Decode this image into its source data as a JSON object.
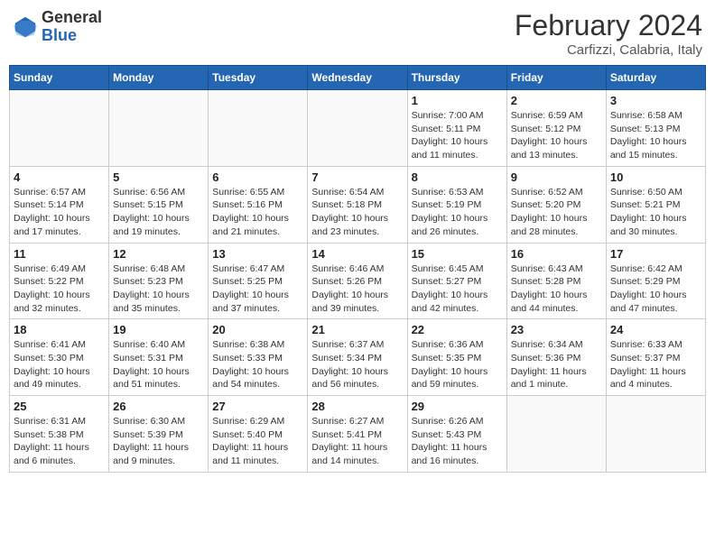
{
  "header": {
    "logo_line1": "General",
    "logo_line2": "Blue",
    "month_year": "February 2024",
    "location": "Carfizzi, Calabria, Italy"
  },
  "days_of_week": [
    "Sunday",
    "Monday",
    "Tuesday",
    "Wednesday",
    "Thursday",
    "Friday",
    "Saturday"
  ],
  "weeks": [
    [
      {
        "day": "",
        "info": ""
      },
      {
        "day": "",
        "info": ""
      },
      {
        "day": "",
        "info": ""
      },
      {
        "day": "",
        "info": ""
      },
      {
        "day": "1",
        "info": "Sunrise: 7:00 AM\nSunset: 5:11 PM\nDaylight: 10 hours\nand 11 minutes."
      },
      {
        "day": "2",
        "info": "Sunrise: 6:59 AM\nSunset: 5:12 PM\nDaylight: 10 hours\nand 13 minutes."
      },
      {
        "day": "3",
        "info": "Sunrise: 6:58 AM\nSunset: 5:13 PM\nDaylight: 10 hours\nand 15 minutes."
      }
    ],
    [
      {
        "day": "4",
        "info": "Sunrise: 6:57 AM\nSunset: 5:14 PM\nDaylight: 10 hours\nand 17 minutes."
      },
      {
        "day": "5",
        "info": "Sunrise: 6:56 AM\nSunset: 5:15 PM\nDaylight: 10 hours\nand 19 minutes."
      },
      {
        "day": "6",
        "info": "Sunrise: 6:55 AM\nSunset: 5:16 PM\nDaylight: 10 hours\nand 21 minutes."
      },
      {
        "day": "7",
        "info": "Sunrise: 6:54 AM\nSunset: 5:18 PM\nDaylight: 10 hours\nand 23 minutes."
      },
      {
        "day": "8",
        "info": "Sunrise: 6:53 AM\nSunset: 5:19 PM\nDaylight: 10 hours\nand 26 minutes."
      },
      {
        "day": "9",
        "info": "Sunrise: 6:52 AM\nSunset: 5:20 PM\nDaylight: 10 hours\nand 28 minutes."
      },
      {
        "day": "10",
        "info": "Sunrise: 6:50 AM\nSunset: 5:21 PM\nDaylight: 10 hours\nand 30 minutes."
      }
    ],
    [
      {
        "day": "11",
        "info": "Sunrise: 6:49 AM\nSunset: 5:22 PM\nDaylight: 10 hours\nand 32 minutes."
      },
      {
        "day": "12",
        "info": "Sunrise: 6:48 AM\nSunset: 5:23 PM\nDaylight: 10 hours\nand 35 minutes."
      },
      {
        "day": "13",
        "info": "Sunrise: 6:47 AM\nSunset: 5:25 PM\nDaylight: 10 hours\nand 37 minutes."
      },
      {
        "day": "14",
        "info": "Sunrise: 6:46 AM\nSunset: 5:26 PM\nDaylight: 10 hours\nand 39 minutes."
      },
      {
        "day": "15",
        "info": "Sunrise: 6:45 AM\nSunset: 5:27 PM\nDaylight: 10 hours\nand 42 minutes."
      },
      {
        "day": "16",
        "info": "Sunrise: 6:43 AM\nSunset: 5:28 PM\nDaylight: 10 hours\nand 44 minutes."
      },
      {
        "day": "17",
        "info": "Sunrise: 6:42 AM\nSunset: 5:29 PM\nDaylight: 10 hours\nand 47 minutes."
      }
    ],
    [
      {
        "day": "18",
        "info": "Sunrise: 6:41 AM\nSunset: 5:30 PM\nDaylight: 10 hours\nand 49 minutes."
      },
      {
        "day": "19",
        "info": "Sunrise: 6:40 AM\nSunset: 5:31 PM\nDaylight: 10 hours\nand 51 minutes."
      },
      {
        "day": "20",
        "info": "Sunrise: 6:38 AM\nSunset: 5:33 PM\nDaylight: 10 hours\nand 54 minutes."
      },
      {
        "day": "21",
        "info": "Sunrise: 6:37 AM\nSunset: 5:34 PM\nDaylight: 10 hours\nand 56 minutes."
      },
      {
        "day": "22",
        "info": "Sunrise: 6:36 AM\nSunset: 5:35 PM\nDaylight: 10 hours\nand 59 minutes."
      },
      {
        "day": "23",
        "info": "Sunrise: 6:34 AM\nSunset: 5:36 PM\nDaylight: 11 hours\nand 1 minute."
      },
      {
        "day": "24",
        "info": "Sunrise: 6:33 AM\nSunset: 5:37 PM\nDaylight: 11 hours\nand 4 minutes."
      }
    ],
    [
      {
        "day": "25",
        "info": "Sunrise: 6:31 AM\nSunset: 5:38 PM\nDaylight: 11 hours\nand 6 minutes."
      },
      {
        "day": "26",
        "info": "Sunrise: 6:30 AM\nSunset: 5:39 PM\nDaylight: 11 hours\nand 9 minutes."
      },
      {
        "day": "27",
        "info": "Sunrise: 6:29 AM\nSunset: 5:40 PM\nDaylight: 11 hours\nand 11 minutes."
      },
      {
        "day": "28",
        "info": "Sunrise: 6:27 AM\nSunset: 5:41 PM\nDaylight: 11 hours\nand 14 minutes."
      },
      {
        "day": "29",
        "info": "Sunrise: 6:26 AM\nSunset: 5:43 PM\nDaylight: 11 hours\nand 16 minutes."
      },
      {
        "day": "",
        "info": ""
      },
      {
        "day": "",
        "info": ""
      }
    ]
  ]
}
